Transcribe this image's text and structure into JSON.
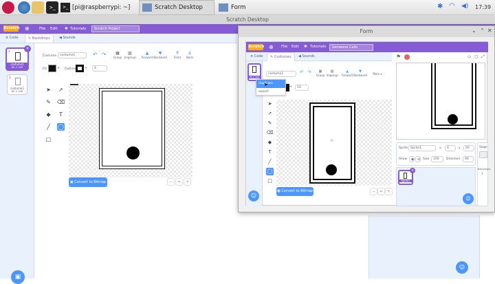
{
  "taskbar": {
    "tasks": [
      {
        "label": "[pi@raspberrypi: ~]"
      },
      {
        "label": "Scratch Desktop"
      },
      {
        "label": "Form"
      }
    ],
    "clock": "17:39"
  },
  "back_window": {
    "title": "Scratch Desktop",
    "menu": {
      "logo": "Scratch",
      "file": "File",
      "edit": "Edit",
      "tutorials": "Tutorials",
      "project_title": "Scratch Project"
    },
    "tabs": {
      "code": "Code",
      "backdrops": "Backdrops",
      "sounds": "Sounds"
    },
    "thumbnails": [
      {
        "index": "1",
        "name": "costume1",
        "size": "60 × 109"
      },
      {
        "index": "2",
        "name": "costume1",
        "size": "60 × 108"
      }
    ],
    "toolbar": {
      "costume_label": "Costume",
      "costume_name": "costume1",
      "group": "Group",
      "ungroup": "Ungroup",
      "forward": "Forward",
      "backward": "Backward",
      "front": "Front",
      "back": "Back",
      "fill": "Fill",
      "outline": "Outline",
      "outline_width": "4"
    },
    "convert_button": "Convert to Bitmap"
  },
  "form_window": {
    "title": "Form",
    "menu": {
      "logo": "Scratch",
      "file": "File",
      "edit": "Edit",
      "tutorials": "Tutorials",
      "project_title": "Someone Calls"
    },
    "tabs": {
      "code": "Code",
      "costumes": "Costumes",
      "sounds": "Sounds"
    },
    "thumbnail_size": "60 × 109",
    "toolbar": {
      "costume_name": "costume1",
      "group": "Group",
      "ungroup": "Ungroup",
      "forward": "Forward",
      "backward": "Backward",
      "more": "More",
      "outline_width": "10"
    },
    "dropdown": {
      "items": [
        "duplicate",
        "export"
      ]
    },
    "convert_button": "Convert to Bitmap",
    "sprite_info": {
      "sprite_label": "Sprite",
      "sprite_name": "Sprite1",
      "x_label": "x",
      "x_value": "0",
      "y_label": "y",
      "y_value": "20",
      "show_label": "Show",
      "size_label": "Size",
      "size_value": "100",
      "direction_label": "Direction",
      "direction_value": "90"
    },
    "sprite_tile": "Sprite1",
    "stage_label": "Stage",
    "backdrops_label": "Backdrops",
    "backdrops_count": "1"
  },
  "colors": {
    "scratch_purple": "#855cd6",
    "scratch_blue": "#4c97ff",
    "logo_orange": "#ffab19"
  }
}
